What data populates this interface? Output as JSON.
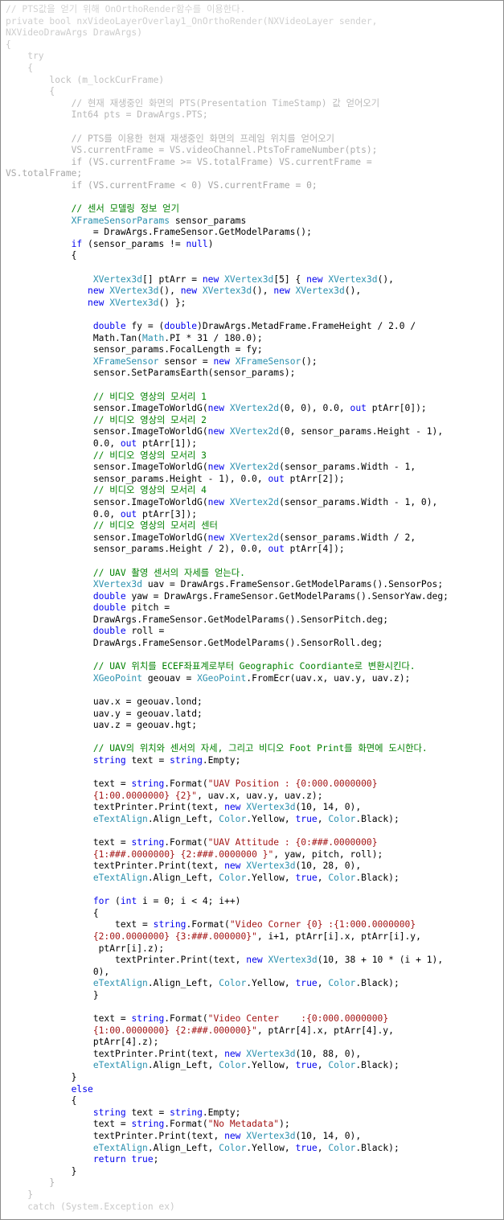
{
  "code": {
    "lines": [
      [
        {
          "t": "// PTS값을 얻기 위해 OnOrthoRender함수를 이용한다.",
          "c": "fade"
        }
      ],
      [
        {
          "t": "private bool nxVideoLayerOverlay1_OnOrthoRender(NXVideoLayer sender,",
          "c": "fade"
        }
      ],
      [
        {
          "t": "NXVideoDrawArgs DrawArgs)",
          "c": "fade"
        }
      ],
      [
        {
          "t": "{",
          "c": "fade"
        }
      ],
      [
        {
          "t": "    try",
          "c": "fade"
        }
      ],
      [
        {
          "t": "    {",
          "c": "fade"
        }
      ],
      [
        {
          "t": "        lock (m_lockCurFrame)",
          "c": "fade"
        }
      ],
      [
        {
          "t": "        {",
          "c": "fade"
        }
      ],
      [
        {
          "t": "            // 현재 재생중인 화면의 PTS(Presentation TimeStamp) 값 얻어오기",
          "c": "fade"
        }
      ],
      [
        {
          "t": "            Int64 pts = DrawArgs.PTS;",
          "c": "fade"
        }
      ],
      [],
      [
        {
          "t": "            // PTS를 이용한 현재 재생중인 화면의 프레임 위치를 얻어오기",
          "c": "fade"
        }
      ],
      [
        {
          "t": "            VS.currentFrame = VS.videoChannel.PtsToFrameNumber(pts);",
          "c": "fade"
        }
      ],
      [
        {
          "t": "            if (VS.currentFrame >= VS.totalFrame) VS.currentFrame =",
          "c": "fade"
        }
      ],
      [
        {
          "t": "VS.totalFrame;",
          "c": "fade"
        }
      ],
      [
        {
          "t": "            if (VS.currentFrame < 0) VS.currentFrame = 0;",
          "c": "fade"
        }
      ],
      [],
      [
        {
          "t": "            // 센서 모델링 정보 얻기",
          "c": "cm"
        }
      ],
      [
        {
          "t": "            "
        },
        {
          "t": "XFrameSensorParams",
          "c": "ty"
        },
        {
          "t": " sensor_params"
        }
      ],
      [
        {
          "t": "                = DrawArgs.FrameSensor.GetModelParams();"
        }
      ],
      [
        {
          "t": "            "
        },
        {
          "t": "if",
          "c": "kw"
        },
        {
          "t": " (sensor_params != "
        },
        {
          "t": "null",
          "c": "kw"
        },
        {
          "t": ")"
        }
      ],
      [
        {
          "t": "            {"
        }
      ],
      [],
      [
        {
          "t": "                "
        },
        {
          "t": "XVertex3d",
          "c": "ty"
        },
        {
          "t": "[] ptArr = "
        },
        {
          "t": "new",
          "c": "kw"
        },
        {
          "t": " "
        },
        {
          "t": "XVertex3d",
          "c": "ty"
        },
        {
          "t": "[5] { "
        },
        {
          "t": "new",
          "c": "kw"
        },
        {
          "t": " "
        },
        {
          "t": "XVertex3d",
          "c": "ty"
        },
        {
          "t": "(),"
        }
      ],
      [
        {
          "t": "               "
        },
        {
          "t": "new",
          "c": "kw"
        },
        {
          "t": " "
        },
        {
          "t": "XVertex3d",
          "c": "ty"
        },
        {
          "t": "(), "
        },
        {
          "t": "new",
          "c": "kw"
        },
        {
          "t": " "
        },
        {
          "t": "XVertex3d",
          "c": "ty"
        },
        {
          "t": "(), "
        },
        {
          "t": "new",
          "c": "kw"
        },
        {
          "t": " "
        },
        {
          "t": "XVertex3d",
          "c": "ty"
        },
        {
          "t": "(),"
        }
      ],
      [
        {
          "t": "               "
        },
        {
          "t": "new",
          "c": "kw"
        },
        {
          "t": " "
        },
        {
          "t": "XVertex3d",
          "c": "ty"
        },
        {
          "t": "() };"
        }
      ],
      [],
      [
        {
          "t": "                "
        },
        {
          "t": "double",
          "c": "kw"
        },
        {
          "t": " fy = ("
        },
        {
          "t": "double",
          "c": "kw"
        },
        {
          "t": ")DrawArgs.MetadFrame.FrameHeight / 2.0 /"
        }
      ],
      [
        {
          "t": "                Math.Tan("
        },
        {
          "t": "Math",
          "c": "ty"
        },
        {
          "t": ".PI * 31 / 180.0);"
        }
      ],
      [
        {
          "t": "                sensor_params.FocalLength = fy;"
        }
      ],
      [
        {
          "t": "                "
        },
        {
          "t": "XFrameSensor",
          "c": "ty"
        },
        {
          "t": " sensor = "
        },
        {
          "t": "new",
          "c": "kw"
        },
        {
          "t": " "
        },
        {
          "t": "XFrameSensor",
          "c": "ty"
        },
        {
          "t": "();"
        }
      ],
      [
        {
          "t": "                sensor.SetParamsEarth(sensor_params);"
        }
      ],
      [],
      [
        {
          "t": "                // 비디오 영상의 모서리 1",
          "c": "cm"
        }
      ],
      [
        {
          "t": "                sensor.ImageToWorldG("
        },
        {
          "t": "new",
          "c": "kw"
        },
        {
          "t": " "
        },
        {
          "t": "XVertex2d",
          "c": "ty"
        },
        {
          "t": "(0, 0), 0.0, "
        },
        {
          "t": "out",
          "c": "kw"
        },
        {
          "t": " ptArr[0]);"
        }
      ],
      [
        {
          "t": "                // 비디오 영상의 모서리 2",
          "c": "cm"
        }
      ],
      [
        {
          "t": "                sensor.ImageToWorldG("
        },
        {
          "t": "new",
          "c": "kw"
        },
        {
          "t": " "
        },
        {
          "t": "XVertex2d",
          "c": "ty"
        },
        {
          "t": "(0, sensor_params.Height - 1),"
        }
      ],
      [
        {
          "t": "                0.0, "
        },
        {
          "t": "out",
          "c": "kw"
        },
        {
          "t": " ptArr[1]);"
        }
      ],
      [
        {
          "t": "                // 비디오 영상의 모서리 3",
          "c": "cm"
        }
      ],
      [
        {
          "t": "                sensor.ImageToWorldG("
        },
        {
          "t": "new",
          "c": "kw"
        },
        {
          "t": " "
        },
        {
          "t": "XVertex2d",
          "c": "ty"
        },
        {
          "t": "(sensor_params.Width - 1,"
        }
      ],
      [
        {
          "t": "                sensor_params.Height - 1), 0.0, "
        },
        {
          "t": "out",
          "c": "kw"
        },
        {
          "t": " ptArr[2]);"
        }
      ],
      [
        {
          "t": "                // 비디오 영상의 모서리 4",
          "c": "cm"
        }
      ],
      [
        {
          "t": "                sensor.ImageToWorldG("
        },
        {
          "t": "new",
          "c": "kw"
        },
        {
          "t": " "
        },
        {
          "t": "XVertex2d",
          "c": "ty"
        },
        {
          "t": "(sensor_params.Width - 1, 0),"
        }
      ],
      [
        {
          "t": "                0.0, "
        },
        {
          "t": "out",
          "c": "kw"
        },
        {
          "t": " ptArr[3]);"
        }
      ],
      [
        {
          "t": "                // 비디오 영상의 모서리 센터",
          "c": "cm"
        }
      ],
      [
        {
          "t": "                sensor.ImageToWorldG("
        },
        {
          "t": "new",
          "c": "kw"
        },
        {
          "t": " "
        },
        {
          "t": "XVertex2d",
          "c": "ty"
        },
        {
          "t": "(sensor_params.Width / 2,"
        }
      ],
      [
        {
          "t": "                sensor_params.Height / 2), 0.0, "
        },
        {
          "t": "out",
          "c": "kw"
        },
        {
          "t": " ptArr[4]);"
        }
      ],
      [],
      [
        {
          "t": "                // UAV 촬영 센서의 자세를 얻는다.",
          "c": "cm"
        }
      ],
      [
        {
          "t": "                "
        },
        {
          "t": "XVertex3d",
          "c": "ty"
        },
        {
          "t": " uav = DrawArgs.FrameSensor.GetModelParams().SensorPos;"
        }
      ],
      [
        {
          "t": "                "
        },
        {
          "t": "double",
          "c": "kw"
        },
        {
          "t": " yaw = DrawArgs.FrameSensor.GetModelParams().SensorYaw.deg;"
        }
      ],
      [
        {
          "t": "                "
        },
        {
          "t": "double",
          "c": "kw"
        },
        {
          "t": " pitch ="
        }
      ],
      [
        {
          "t": "                DrawArgs.FrameSensor.GetModelParams().SensorPitch.deg;"
        }
      ],
      [
        {
          "t": "                "
        },
        {
          "t": "double",
          "c": "kw"
        },
        {
          "t": " roll ="
        }
      ],
      [
        {
          "t": "                DrawArgs.FrameSensor.GetModelParams().SensorRoll.deg;"
        }
      ],
      [],
      [
        {
          "t": "                // UAV 위치를 ECEF좌표계로부터 Geographic Coordiante로 변환시킨다.",
          "c": "cm"
        }
      ],
      [
        {
          "t": "                "
        },
        {
          "t": "XGeoPoint",
          "c": "ty"
        },
        {
          "t": " geouav = "
        },
        {
          "t": "XGeoPoint",
          "c": "ty"
        },
        {
          "t": ".FromEcr(uav.x, uav.y, uav.z);"
        }
      ],
      [],
      [
        {
          "t": "                uav.x = geouav.lond;"
        }
      ],
      [
        {
          "t": "                uav.y = geouav.latd;"
        }
      ],
      [
        {
          "t": "                uav.z = geouav.hgt;"
        }
      ],
      [],
      [
        {
          "t": "                // UAV의 위치와 센서의 자세, 그리고 비디오 Foot Print를 화면에 도시한다.",
          "c": "cm"
        }
      ],
      [
        {
          "t": "                "
        },
        {
          "t": "string",
          "c": "kw"
        },
        {
          "t": " text = "
        },
        {
          "t": "string",
          "c": "kw"
        },
        {
          "t": ".Empty;"
        }
      ],
      [],
      [
        {
          "t": "                text = "
        },
        {
          "t": "string",
          "c": "kw"
        },
        {
          "t": ".Format("
        },
        {
          "t": "\"UAV Position : {0:000.0000000}",
          "c": "st"
        }
      ],
      [
        {
          "t": "                "
        },
        {
          "t": "{1:00.0000000} {2}\"",
          "c": "st"
        },
        {
          "t": ", uav.x, uav.y, uav.z);"
        }
      ],
      [
        {
          "t": "                textPrinter.Print(text, "
        },
        {
          "t": "new",
          "c": "kw"
        },
        {
          "t": " "
        },
        {
          "t": "XVertex3d",
          "c": "ty"
        },
        {
          "t": "(10, 14, 0),"
        }
      ],
      [
        {
          "t": "                "
        },
        {
          "t": "eTextAlign",
          "c": "ty"
        },
        {
          "t": ".Align_Left, "
        },
        {
          "t": "Color",
          "c": "ty"
        },
        {
          "t": ".Yellow, "
        },
        {
          "t": "true",
          "c": "kw"
        },
        {
          "t": ", "
        },
        {
          "t": "Color",
          "c": "ty"
        },
        {
          "t": ".Black);"
        }
      ],
      [],
      [
        {
          "t": "                text = "
        },
        {
          "t": "string",
          "c": "kw"
        },
        {
          "t": ".Format("
        },
        {
          "t": "\"UAV Attitude : {0:###.0000000}",
          "c": "st"
        }
      ],
      [
        {
          "t": "                "
        },
        {
          "t": "{1:###.0000000} {2:###.0000000 }\"",
          "c": "st"
        },
        {
          "t": ", yaw, pitch, roll);"
        }
      ],
      [
        {
          "t": "                textPrinter.Print(text, "
        },
        {
          "t": "new",
          "c": "kw"
        },
        {
          "t": " "
        },
        {
          "t": "XVertex3d",
          "c": "ty"
        },
        {
          "t": "(10, 28, 0),"
        }
      ],
      [
        {
          "t": "                "
        },
        {
          "t": "eTextAlign",
          "c": "ty"
        },
        {
          "t": ".Align_Left, "
        },
        {
          "t": "Color",
          "c": "ty"
        },
        {
          "t": ".Yellow, "
        },
        {
          "t": "true",
          "c": "kw"
        },
        {
          "t": ", "
        },
        {
          "t": "Color",
          "c": "ty"
        },
        {
          "t": ".Black);"
        }
      ],
      [],
      [
        {
          "t": "                "
        },
        {
          "t": "for",
          "c": "kw"
        },
        {
          "t": " ("
        },
        {
          "t": "int",
          "c": "kw"
        },
        {
          "t": " i = 0; i < 4; i++)"
        }
      ],
      [
        {
          "t": "                {"
        }
      ],
      [
        {
          "t": "                    text = "
        },
        {
          "t": "string",
          "c": "kw"
        },
        {
          "t": ".Format("
        },
        {
          "t": "\"Video Corner {0} :{1:000.0000000}",
          "c": "st"
        }
      ],
      [
        {
          "t": "                "
        },
        {
          "t": "{2:00.0000000} {3:###.000000}\"",
          "c": "st"
        },
        {
          "t": ", i+1, ptArr[i].x, ptArr[i].y,"
        }
      ],
      [
        {
          "t": "                 ptArr[i].z);"
        }
      ],
      [
        {
          "t": "                    textPrinter.Print(text, "
        },
        {
          "t": "new",
          "c": "kw"
        },
        {
          "t": " "
        },
        {
          "t": "XVertex3d",
          "c": "ty"
        },
        {
          "t": "(10, 38 + 10 * (i + 1),"
        }
      ],
      [
        {
          "t": "                0),"
        }
      ],
      [
        {
          "t": "                "
        },
        {
          "t": "eTextAlign",
          "c": "ty"
        },
        {
          "t": ".Align_Left, "
        },
        {
          "t": "Color",
          "c": "ty"
        },
        {
          "t": ".Yellow, "
        },
        {
          "t": "true",
          "c": "kw"
        },
        {
          "t": ", "
        },
        {
          "t": "Color",
          "c": "ty"
        },
        {
          "t": ".Black);"
        }
      ],
      [
        {
          "t": "                }"
        }
      ],
      [],
      [
        {
          "t": "                text = "
        },
        {
          "t": "string",
          "c": "kw"
        },
        {
          "t": ".Format("
        },
        {
          "t": "\"Video Center    :{0:000.0000000}",
          "c": "st"
        }
      ],
      [
        {
          "t": "                "
        },
        {
          "t": "{1:00.0000000} {2:###.000000}\"",
          "c": "st"
        },
        {
          "t": ", ptArr[4].x, ptArr[4].y,"
        }
      ],
      [
        {
          "t": "                ptArr[4].z);"
        }
      ],
      [
        {
          "t": "                textPrinter.Print(text, "
        },
        {
          "t": "new",
          "c": "kw"
        },
        {
          "t": " "
        },
        {
          "t": "XVertex3d",
          "c": "ty"
        },
        {
          "t": "(10, 88, 0),"
        }
      ],
      [
        {
          "t": "                "
        },
        {
          "t": "eTextAlign",
          "c": "ty"
        },
        {
          "t": ".Align_Left, "
        },
        {
          "t": "Color",
          "c": "ty"
        },
        {
          "t": ".Yellow, "
        },
        {
          "t": "true",
          "c": "kw"
        },
        {
          "t": ", "
        },
        {
          "t": "Color",
          "c": "ty"
        },
        {
          "t": ".Black);"
        }
      ],
      [
        {
          "t": "            }"
        }
      ],
      [
        {
          "t": "            "
        },
        {
          "t": "else",
          "c": "kw"
        }
      ],
      [
        {
          "t": "            {"
        }
      ],
      [
        {
          "t": "                "
        },
        {
          "t": "string",
          "c": "kw"
        },
        {
          "t": " text = "
        },
        {
          "t": "string",
          "c": "kw"
        },
        {
          "t": ".Empty;"
        }
      ],
      [
        {
          "t": "                text = "
        },
        {
          "t": "string",
          "c": "kw"
        },
        {
          "t": ".Format("
        },
        {
          "t": "\"No Metadata\"",
          "c": "st"
        },
        {
          "t": ");"
        }
      ],
      [
        {
          "t": "                textPrinter.Print(text, "
        },
        {
          "t": "new",
          "c": "kw"
        },
        {
          "t": " "
        },
        {
          "t": "XVertex3d",
          "c": "ty"
        },
        {
          "t": "(10, 14, 0),"
        }
      ],
      [
        {
          "t": "                "
        },
        {
          "t": "eTextAlign",
          "c": "ty"
        },
        {
          "t": ".Align_Left, "
        },
        {
          "t": "Color",
          "c": "ty"
        },
        {
          "t": ".Yellow, "
        },
        {
          "t": "true",
          "c": "kw"
        },
        {
          "t": ", "
        },
        {
          "t": "Color",
          "c": "ty"
        },
        {
          "t": ".Black);"
        }
      ],
      [
        {
          "t": "                "
        },
        {
          "t": "return",
          "c": "kw"
        },
        {
          "t": " "
        },
        {
          "t": "true",
          "c": "kw"
        },
        {
          "t": ";"
        }
      ],
      [
        {
          "t": "            }"
        }
      ],
      [
        {
          "t": "        }",
          "c": "fade"
        }
      ],
      [
        {
          "t": "    }",
          "c": "fade"
        }
      ],
      [
        {
          "t": "    catch (System.Exception ex)",
          "c": "fade"
        }
      ]
    ]
  },
  "colors": {
    "keyword": "#0000ee",
    "type": "#2b91af",
    "comment": "#008000",
    "string": "#a31515",
    "faded": "#a3a3a3",
    "border": "#8c8c8c"
  }
}
